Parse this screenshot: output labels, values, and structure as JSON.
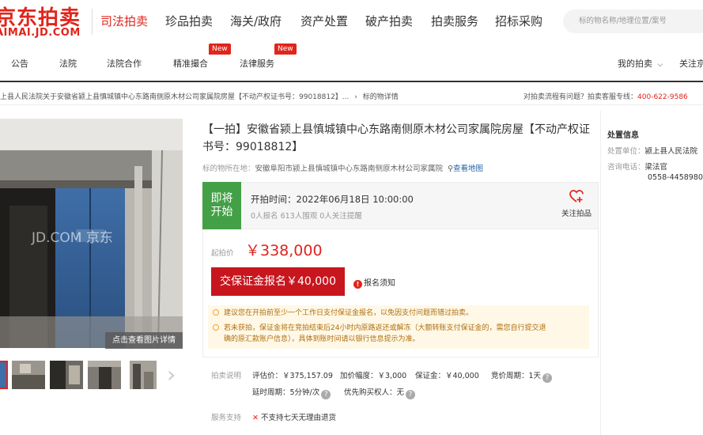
{
  "header": {
    "logo_cn": "京东拍卖",
    "logo_en": "AIMAI.JD.COM",
    "nav": [
      "司法拍卖",
      "珍品拍卖",
      "海关/政府",
      "资产处置",
      "破产拍卖",
      "拍卖服务",
      "招标采购"
    ],
    "search_placeholder": "标的物名称/地理位置/案号"
  },
  "subnav": {
    "items": [
      "公告",
      "法院",
      "法院合作",
      "精准撮合",
      "法律服务"
    ],
    "new_badge": "New",
    "my_auction": "我的拍卖",
    "follow_jd": "关注京"
  },
  "breadcrumb": {
    "path": "上县人民法院关于安徽省颍上县慎城镇中心东路南侧原木材公司家属院房屋【不动产权证书号：99018812】...",
    "current": "标的物详情",
    "hotline_label": "对拍卖流程有问题？拍卖客服专线：",
    "hotline_number": "400-622-9586"
  },
  "gallery": {
    "watermark": "JD.COM 京东",
    "view_button": "点击查看图片详情",
    "thumb_count": 5
  },
  "item": {
    "title": "【一拍】安徽省颍上县慎城镇中心东路南侧原木材公司家属院房屋【不动产权证书号：99018812】",
    "location_label": "标的物所在地：",
    "location": "安徽阜阳市颍上县慎城镇中心东路南侧原木材公司家属院",
    "map_link": "查看地图"
  },
  "status": {
    "line1": "即将",
    "line2": "开始",
    "start_time": "开拍时间：2022年06月18日 10:00:00",
    "counts": "0人报名   613人围观   0人关注提醒",
    "follow_label": "关注拍品"
  },
  "price": {
    "start_label": "起拍价",
    "start_price": "￥338,000",
    "deposit_button": "交保证金报名￥40,000",
    "notice": "报名须知"
  },
  "tips": [
    "建议您在开拍前至少一个工作日支付保证金报名，以免因支付问题而错过拍卖。",
    "若未获拍，保证金将在竞拍结束后24小时内原路返还或解冻（大额转账支付保证金的，需您自行提交退",
    "确的原汇款账户信息），具体到账时间请以银行信息提示为准。"
  ],
  "desc": {
    "label": "拍卖说明",
    "appraisal": "评估价：￥375,157.09",
    "increment": "加价幅度：￥3,000",
    "deposit": "保证金：￥40,000",
    "period": "竞价周期：1天",
    "delay": "延时周期：5分钟/次",
    "priority": "优先购买权人：无"
  },
  "service": {
    "label": "服务支持",
    "value": "不支持七天无理由退货"
  },
  "side": {
    "title": "处置信息",
    "unit_label": "处置单位：",
    "unit": "颍上县人民法院",
    "contact_label": "咨询电话：",
    "contact_name": "梁法官",
    "contact_phone": "0558-4458980"
  }
}
